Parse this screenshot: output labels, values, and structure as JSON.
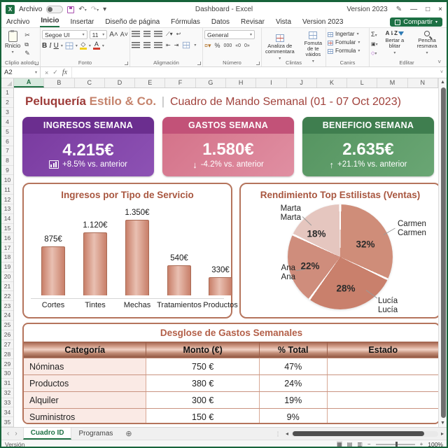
{
  "titlebar": {
    "archivo_label": "Archivo",
    "doc_title": "Dashboard - Excel",
    "version_label": "Version 2023"
  },
  "menubar": {
    "items": [
      "Archivo",
      "Inicio",
      "Insertar",
      "Diseño de página",
      "Fórmulas",
      "Datos",
      "Revisar",
      "Vista",
      "Version 2023"
    ],
    "active_item": "Inicio",
    "share_label": "Compartir"
  },
  "ribbon": {
    "clipboard": {
      "group_label": "Cliplio aolodo",
      "paste_label": "Rnicio"
    },
    "font": {
      "group_label": "Fonto",
      "font_name": "Segoe UI",
      "font_size": "11"
    },
    "alignment": {
      "group_label": "Aligmación"
    },
    "number": {
      "group_label": "Número",
      "format": "General"
    },
    "styles": {
      "group_label": "Clintas",
      "btn1": "Analiza de commentara",
      "btn2": "Fomuta de te váidos"
    },
    "cells": {
      "group_label": "Canirs",
      "btn1": "Ingertar",
      "btn2": "Fomular",
      "btn3": "Formula"
    },
    "editing": {
      "group_label": "Edlitar",
      "btn1": "Bertar a blitar",
      "btn2": "Pencha resmava"
    }
  },
  "formula_bar": {
    "name_box": "A2",
    "fx_label": "fx"
  },
  "grid": {
    "columns": [
      "A",
      "B",
      "C",
      "D",
      "E",
      "F",
      "G",
      "H",
      "I",
      "J",
      "K",
      "L",
      "M",
      "N"
    ],
    "selected_column": "A",
    "row_numbers": [
      1,
      2,
      3,
      4,
      5,
      6,
      7,
      8,
      9,
      10,
      11,
      12,
      13,
      14,
      15,
      16,
      17,
      18,
      19,
      20,
      21,
      22,
      23,
      24,
      25,
      26,
      27,
      28,
      29,
      30,
      31,
      32,
      33,
      34,
      35
    ]
  },
  "dashboard": {
    "title": {
      "brand_1": "Peluquería",
      "brand_2": "Estilo & Co.",
      "separator": "|",
      "subtitle": "Cuadro de Mando Semanal (01 - 07 Oct 2023)"
    },
    "kpi_cards": [
      {
        "title": "INGRESOS SEMANA",
        "value": "4.215€",
        "delta": "+8.5% vs. anterior",
        "icon": "bar-chart-icon",
        "header_color": "#6b2e8f",
        "body_color_1": "#7a3ba0",
        "body_color_2": "#8d52b4"
      },
      {
        "title": "GASTOS SEMANA",
        "value": "1.580€",
        "delta": "-4.2% vs. anterior",
        "icon": "down-arrow-icon",
        "arrow": "↓",
        "header_color": "#c25278",
        "body_color_1": "#d4738a",
        "body_color_2": "#e08fa2"
      },
      {
        "title": "BENEFICIO SEMANA",
        "value": "2.635€",
        "delta": "+21.1% vs. anterior",
        "icon": "up-arrow-icon",
        "arrow": "↑",
        "header_color": "#3f7e4f",
        "body_color_1": "#569561",
        "body_color_2": "#6aa674"
      }
    ]
  },
  "chart_data": [
    {
      "type": "bar",
      "title": "Ingresos por Tipo de Servicio",
      "categories": [
        "Cortes",
        "Tintes",
        "Mechas",
        "Tratamientos",
        "Productos"
      ],
      "values": [
        875,
        1120,
        1350,
        540,
        330
      ],
      "value_labels": [
        "875€",
        "1.120€",
        "1.350€",
        "540€",
        "330€"
      ],
      "xlabel": "",
      "ylabel": "",
      "ylim": [
        0,
        1500
      ],
      "grid": false,
      "bar_color": "#c87f69"
    },
    {
      "type": "pie",
      "title": "Rendimiento Top Estilistas (Ventas)",
      "labels": [
        "Carmen",
        "Lucía",
        "Ana",
        "Marta"
      ],
      "values_pct": [
        32,
        28,
        22,
        18
      ],
      "pct_labels": [
        "32%",
        "28%",
        "22%",
        "18%"
      ],
      "colors": [
        "#cf8d79",
        "#c9806c",
        "#cf8d7c",
        "#e5c6bf"
      ],
      "start_angle_deg": 0,
      "direction": "clockwise",
      "legend_position": "callout-labels"
    }
  ],
  "expenses_table": {
    "title": "Desglose de Gastos Semanales",
    "headers": [
      "Categoría",
      "Monto (€)",
      "% Total",
      "Estado"
    ],
    "rows": [
      {
        "category": "Nóminas",
        "amount": "750 €",
        "percent": "47%",
        "status": ""
      },
      {
        "category": "Productos",
        "amount": "380 €",
        "percent": "24%",
        "status": ""
      },
      {
        "category": "Alquiler",
        "amount": "300 €",
        "percent": "19%",
        "status": ""
      },
      {
        "category": "Suministros",
        "amount": "150 €",
        "percent": "9%",
        "status": ""
      }
    ]
  },
  "sheet_tabs": {
    "tabs": [
      "Cuadro ID",
      "Programas"
    ],
    "active_tab": "Cuadro ID"
  },
  "status_bar": {
    "left_text": "Versión",
    "zoom_level": "100%"
  }
}
